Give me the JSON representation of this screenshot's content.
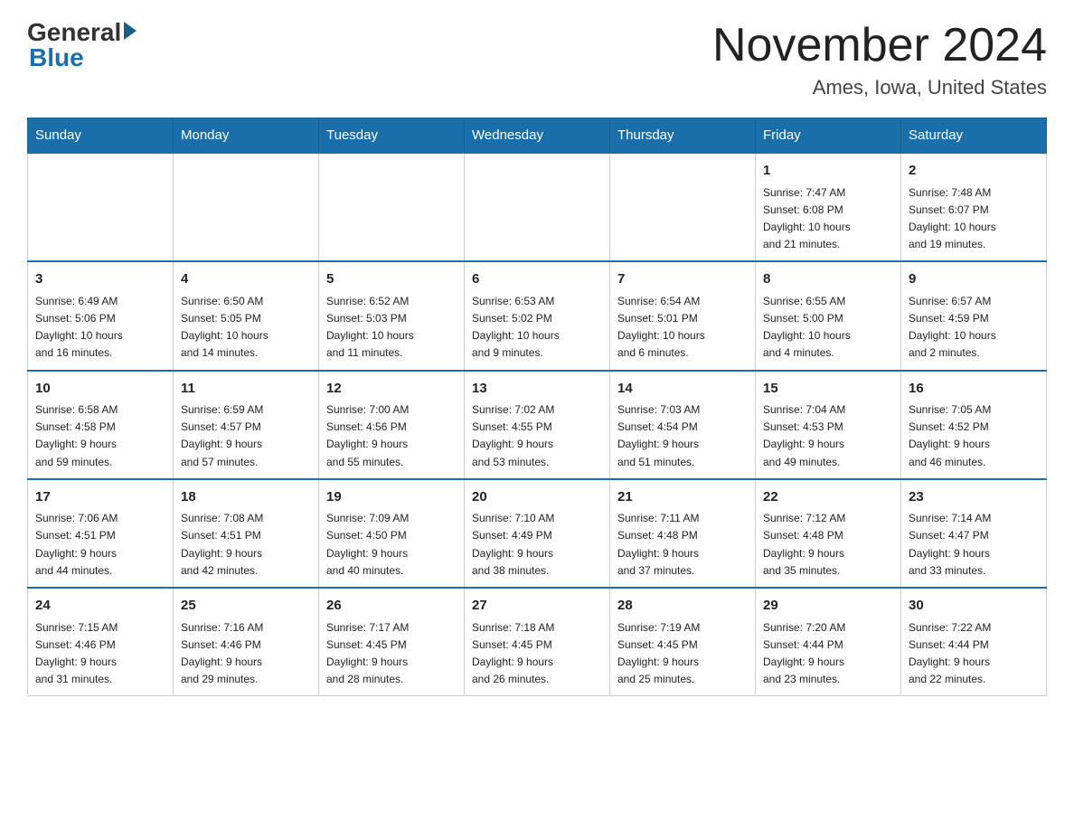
{
  "header": {
    "logo_general": "General",
    "logo_blue": "Blue",
    "month_title": "November 2024",
    "location": "Ames, Iowa, United States"
  },
  "weekdays": [
    "Sunday",
    "Monday",
    "Tuesday",
    "Wednesday",
    "Thursday",
    "Friday",
    "Saturday"
  ],
  "weeks": [
    [
      {
        "day": "",
        "info": ""
      },
      {
        "day": "",
        "info": ""
      },
      {
        "day": "",
        "info": ""
      },
      {
        "day": "",
        "info": ""
      },
      {
        "day": "",
        "info": ""
      },
      {
        "day": "1",
        "info": "Sunrise: 7:47 AM\nSunset: 6:08 PM\nDaylight: 10 hours\nand 21 minutes."
      },
      {
        "day": "2",
        "info": "Sunrise: 7:48 AM\nSunset: 6:07 PM\nDaylight: 10 hours\nand 19 minutes."
      }
    ],
    [
      {
        "day": "3",
        "info": "Sunrise: 6:49 AM\nSunset: 5:06 PM\nDaylight: 10 hours\nand 16 minutes."
      },
      {
        "day": "4",
        "info": "Sunrise: 6:50 AM\nSunset: 5:05 PM\nDaylight: 10 hours\nand 14 minutes."
      },
      {
        "day": "5",
        "info": "Sunrise: 6:52 AM\nSunset: 5:03 PM\nDaylight: 10 hours\nand 11 minutes."
      },
      {
        "day": "6",
        "info": "Sunrise: 6:53 AM\nSunset: 5:02 PM\nDaylight: 10 hours\nand 9 minutes."
      },
      {
        "day": "7",
        "info": "Sunrise: 6:54 AM\nSunset: 5:01 PM\nDaylight: 10 hours\nand 6 minutes."
      },
      {
        "day": "8",
        "info": "Sunrise: 6:55 AM\nSunset: 5:00 PM\nDaylight: 10 hours\nand 4 minutes."
      },
      {
        "day": "9",
        "info": "Sunrise: 6:57 AM\nSunset: 4:59 PM\nDaylight: 10 hours\nand 2 minutes."
      }
    ],
    [
      {
        "day": "10",
        "info": "Sunrise: 6:58 AM\nSunset: 4:58 PM\nDaylight: 9 hours\nand 59 minutes."
      },
      {
        "day": "11",
        "info": "Sunrise: 6:59 AM\nSunset: 4:57 PM\nDaylight: 9 hours\nand 57 minutes."
      },
      {
        "day": "12",
        "info": "Sunrise: 7:00 AM\nSunset: 4:56 PM\nDaylight: 9 hours\nand 55 minutes."
      },
      {
        "day": "13",
        "info": "Sunrise: 7:02 AM\nSunset: 4:55 PM\nDaylight: 9 hours\nand 53 minutes."
      },
      {
        "day": "14",
        "info": "Sunrise: 7:03 AM\nSunset: 4:54 PM\nDaylight: 9 hours\nand 51 minutes."
      },
      {
        "day": "15",
        "info": "Sunrise: 7:04 AM\nSunset: 4:53 PM\nDaylight: 9 hours\nand 49 minutes."
      },
      {
        "day": "16",
        "info": "Sunrise: 7:05 AM\nSunset: 4:52 PM\nDaylight: 9 hours\nand 46 minutes."
      }
    ],
    [
      {
        "day": "17",
        "info": "Sunrise: 7:06 AM\nSunset: 4:51 PM\nDaylight: 9 hours\nand 44 minutes."
      },
      {
        "day": "18",
        "info": "Sunrise: 7:08 AM\nSunset: 4:51 PM\nDaylight: 9 hours\nand 42 minutes."
      },
      {
        "day": "19",
        "info": "Sunrise: 7:09 AM\nSunset: 4:50 PM\nDaylight: 9 hours\nand 40 minutes."
      },
      {
        "day": "20",
        "info": "Sunrise: 7:10 AM\nSunset: 4:49 PM\nDaylight: 9 hours\nand 38 minutes."
      },
      {
        "day": "21",
        "info": "Sunrise: 7:11 AM\nSunset: 4:48 PM\nDaylight: 9 hours\nand 37 minutes."
      },
      {
        "day": "22",
        "info": "Sunrise: 7:12 AM\nSunset: 4:48 PM\nDaylight: 9 hours\nand 35 minutes."
      },
      {
        "day": "23",
        "info": "Sunrise: 7:14 AM\nSunset: 4:47 PM\nDaylight: 9 hours\nand 33 minutes."
      }
    ],
    [
      {
        "day": "24",
        "info": "Sunrise: 7:15 AM\nSunset: 4:46 PM\nDaylight: 9 hours\nand 31 minutes."
      },
      {
        "day": "25",
        "info": "Sunrise: 7:16 AM\nSunset: 4:46 PM\nDaylight: 9 hours\nand 29 minutes."
      },
      {
        "day": "26",
        "info": "Sunrise: 7:17 AM\nSunset: 4:45 PM\nDaylight: 9 hours\nand 28 minutes."
      },
      {
        "day": "27",
        "info": "Sunrise: 7:18 AM\nSunset: 4:45 PM\nDaylight: 9 hours\nand 26 minutes."
      },
      {
        "day": "28",
        "info": "Sunrise: 7:19 AM\nSunset: 4:45 PM\nDaylight: 9 hours\nand 25 minutes."
      },
      {
        "day": "29",
        "info": "Sunrise: 7:20 AM\nSunset: 4:44 PM\nDaylight: 9 hours\nand 23 minutes."
      },
      {
        "day": "30",
        "info": "Sunrise: 7:22 AM\nSunset: 4:44 PM\nDaylight: 9 hours\nand 22 minutes."
      }
    ]
  ]
}
